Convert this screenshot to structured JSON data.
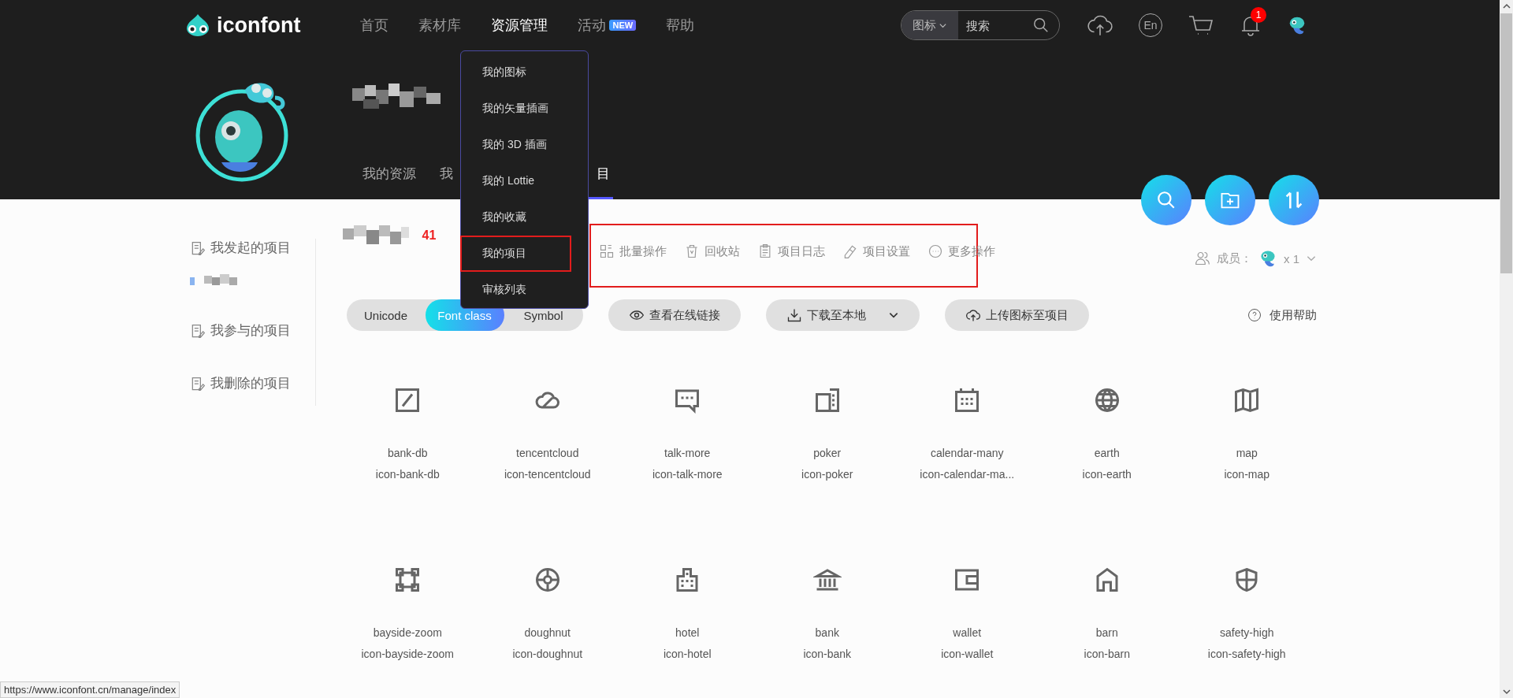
{
  "header": {
    "logo": "iconfont",
    "nav": [
      {
        "label": "首页",
        "selected": false
      },
      {
        "label": "素材库",
        "selected": false
      },
      {
        "label": "资源管理",
        "selected": true
      },
      {
        "label": "活动",
        "selected": false,
        "badge": "NEW"
      },
      {
        "label": "帮助",
        "selected": false
      }
    ],
    "search": {
      "scope": "图标",
      "placeholder": "搜索"
    },
    "language": "En",
    "notifications": "1"
  },
  "profile_tabs": [
    {
      "label": "我的资源",
      "selected": false
    },
    {
      "label": "我",
      "selected": false
    },
    {
      "label": "目",
      "selected": true
    }
  ],
  "dropdown": [
    {
      "label": "我的图标",
      "annotated": false
    },
    {
      "label": "我的矢量插画",
      "annotated": false
    },
    {
      "label": "我的 3D 插画",
      "annotated": false
    },
    {
      "label": "我的 Lottie",
      "annotated": false
    },
    {
      "label": "我的收藏",
      "annotated": false
    },
    {
      "label": "我的项目",
      "annotated": true
    },
    {
      "label": "审核列表",
      "annotated": false
    }
  ],
  "sidebar": [
    {
      "label": "我发起的项目",
      "kind": "group"
    },
    {
      "kind": "project"
    },
    {
      "label": "我参与的项目",
      "kind": "group"
    },
    {
      "label": "我删除的项目",
      "kind": "group"
    }
  ],
  "project": {
    "count": "41",
    "actions_annotated": true,
    "actions": [
      {
        "label": "批量操作",
        "kind": "batch"
      },
      {
        "label": "回收站",
        "kind": "trash"
      },
      {
        "label": "项目日志",
        "kind": "log"
      },
      {
        "label": "项目设置",
        "kind": "edit"
      },
      {
        "label": "更多操作",
        "kind": "more"
      }
    ],
    "members_label": "成员：",
    "members_count": "x 1"
  },
  "view_modes": [
    {
      "label": "Unicode",
      "selected": false
    },
    {
      "label": "Font class",
      "selected": true
    },
    {
      "label": "Symbol",
      "selected": false
    }
  ],
  "buttons": [
    {
      "label": "查看在线链接",
      "kind": "eye"
    },
    {
      "label": "下载至本地",
      "kind": "download"
    },
    {
      "label": "上传图标至项目",
      "kind": "upload"
    }
  ],
  "help": "使用帮助",
  "icons": [
    {
      "name": "bank-db",
      "class": "icon-bank-db"
    },
    {
      "name": "tencentcloud",
      "class": "icon-tencentcloud"
    },
    {
      "name": "talk-more",
      "class": "icon-talk-more"
    },
    {
      "name": "poker",
      "class": "icon-poker"
    },
    {
      "name": "calendar-many",
      "class": "icon-calendar-ma..."
    },
    {
      "name": "earth",
      "class": "icon-earth"
    },
    {
      "name": "map",
      "class": "icon-map"
    },
    {
      "name": "bayside-zoom",
      "class": "icon-bayside-zoom"
    },
    {
      "name": "doughnut",
      "class": "icon-doughnut"
    },
    {
      "name": "hotel",
      "class": "icon-hotel"
    },
    {
      "name": "bank",
      "class": "icon-bank"
    },
    {
      "name": "wallet",
      "class": "icon-wallet"
    },
    {
      "name": "barn",
      "class": "icon-barn"
    },
    {
      "name": "safety-high",
      "class": "icon-safety-high"
    }
  ],
  "status_url": "https://www.iconfont.cn/manage/index"
}
